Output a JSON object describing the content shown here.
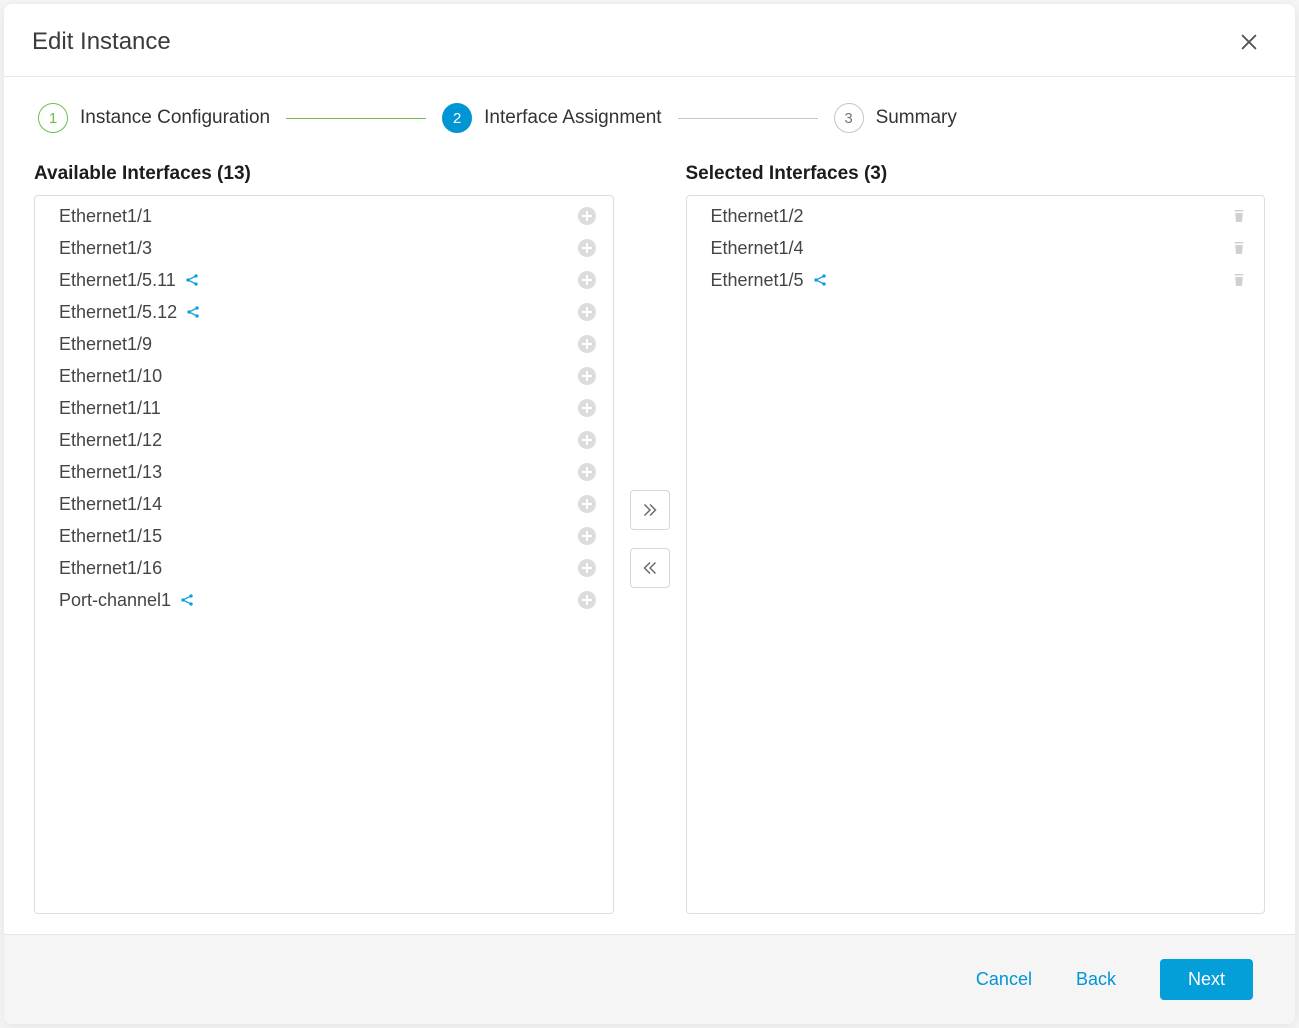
{
  "dialog": {
    "title": "Edit Instance"
  },
  "stepper": {
    "steps": [
      {
        "num": "1",
        "label": "Instance Configuration"
      },
      {
        "num": "2",
        "label": "Interface Assignment"
      },
      {
        "num": "3",
        "label": "Summary"
      }
    ]
  },
  "available": {
    "title": "Available Interfaces (13)",
    "items": [
      {
        "name": "Ethernet1/1",
        "shared": false
      },
      {
        "name": "Ethernet1/3",
        "shared": false
      },
      {
        "name": "Ethernet1/5.11",
        "shared": true
      },
      {
        "name": "Ethernet1/5.12",
        "shared": true
      },
      {
        "name": "Ethernet1/9",
        "shared": false
      },
      {
        "name": "Ethernet1/10",
        "shared": false
      },
      {
        "name": "Ethernet1/11",
        "shared": false
      },
      {
        "name": "Ethernet1/12",
        "shared": false
      },
      {
        "name": "Ethernet1/13",
        "shared": false
      },
      {
        "name": "Ethernet1/14",
        "shared": false
      },
      {
        "name": "Ethernet1/15",
        "shared": false
      },
      {
        "name": "Ethernet1/16",
        "shared": false
      },
      {
        "name": "Port-channel1",
        "shared": true
      }
    ]
  },
  "selected": {
    "title": "Selected Interfaces (3)",
    "items": [
      {
        "name": "Ethernet1/2",
        "shared": false
      },
      {
        "name": "Ethernet1/4",
        "shared": false
      },
      {
        "name": "Ethernet1/5",
        "shared": true
      }
    ]
  },
  "footer": {
    "cancel": "Cancel",
    "back": "Back",
    "next": "Next"
  }
}
